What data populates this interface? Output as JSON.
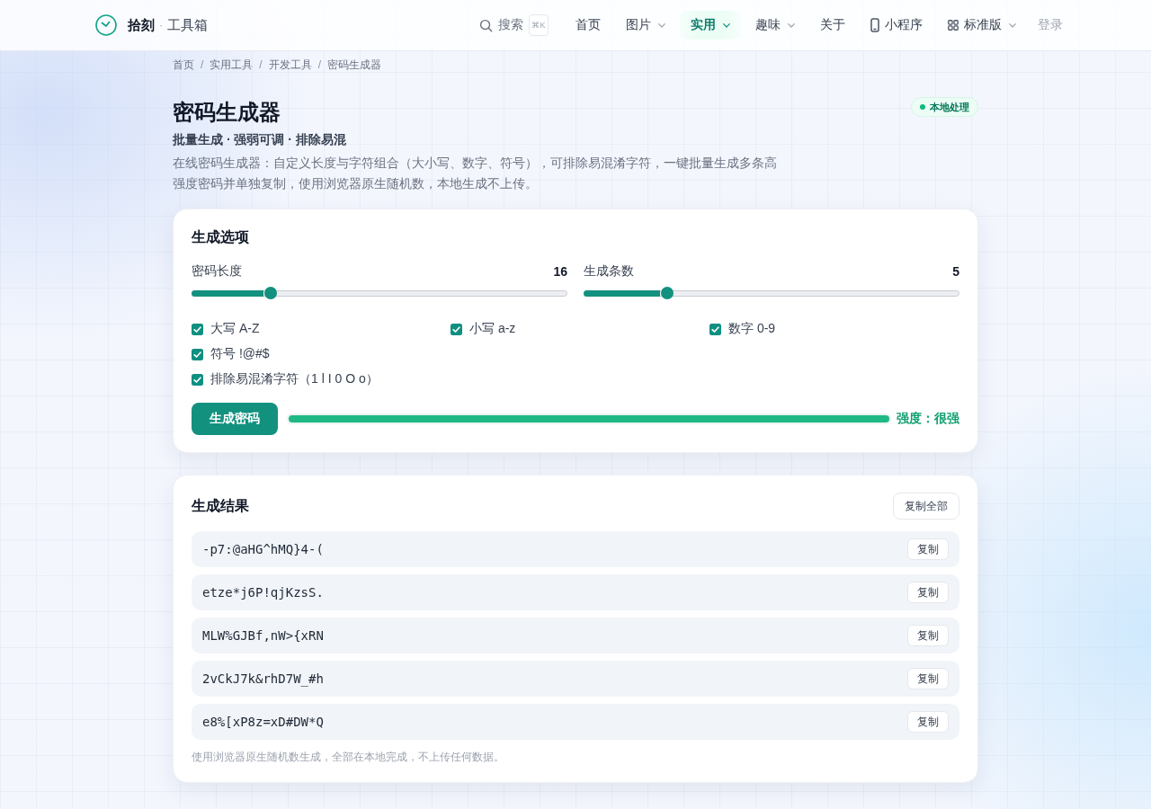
{
  "header": {
    "logo": {
      "name": "拾刻",
      "separator": "·",
      "suffix": "工具箱"
    },
    "search": {
      "label": "搜索",
      "shortcut": "⌘K"
    },
    "nav": [
      {
        "label": "首页",
        "kind": "link",
        "selected": false
      },
      {
        "label": "图片",
        "kind": "dropdown",
        "selected": false
      },
      {
        "label": "实用",
        "kind": "dropdown",
        "selected": true
      },
      {
        "label": "趣味",
        "kind": "dropdown",
        "selected": false
      },
      {
        "label": "关于",
        "kind": "link",
        "selected": false
      },
      {
        "label": "小程序",
        "kind": "miniprogram",
        "selected": false
      },
      {
        "label": "标准版",
        "kind": "edition",
        "selected": false
      }
    ],
    "login": "登录"
  },
  "breadcrumb": {
    "separator": "/",
    "items": [
      "首页",
      "实用工具",
      "开发工具",
      "密码生成器"
    ]
  },
  "hero": {
    "title": "密码生成器",
    "badge": "本地处理",
    "subtitle": "批量生成 · 强弱可调 · 排除易混",
    "description": "在线密码生成器：自定义长度与字符组合（大小写、数字、符号），可排除易混淆字符，一键批量生成多条高强度密码并单独复制，使用浏览器原生随机数，本地生成不上传。"
  },
  "options": {
    "title": "生成选项",
    "sliders": [
      {
        "label": "密码长度",
        "value": "16",
        "level": 0.21
      },
      {
        "label": "生成条数",
        "value": "5",
        "level": 0.22
      }
    ],
    "checkboxes": [
      {
        "label": "大写 A-Z",
        "kind": "charset",
        "checked": true
      },
      {
        "label": "小写 a-z",
        "kind": "charset",
        "checked": true
      },
      {
        "label": "数字 0-9",
        "kind": "charset",
        "checked": true
      },
      {
        "label": "符号 !@#$",
        "kind": "charset",
        "checked": true
      },
      {
        "label": "排除易混淆字符（1 l I 0 O o）",
        "kind": "option",
        "checked": true
      }
    ],
    "generate_button": "生成密码",
    "strength": {
      "level": 1,
      "label": "强度：很强"
    }
  },
  "results": {
    "title": "生成结果",
    "copy_all_button": "复制全部",
    "rows": [
      {
        "password": "-p7:@aHG^hMQ}4-(",
        "copy_button": "复制"
      },
      {
        "password": "etze*j6P!qjKzsS.",
        "copy_button": "复制"
      },
      {
        "password": "MLW%GJBf,nW>{xRN",
        "copy_button": "复制"
      },
      {
        "password": "2vCkJ7k&rhD7W_#h",
        "copy_button": "复制"
      },
      {
        "password": "e8%[xP8z=xD#DW*Q",
        "copy_button": "复制"
      }
    ],
    "note": "使用浏览器原生随机数生成，全部在本地完成，不上传任何数据。"
  }
}
